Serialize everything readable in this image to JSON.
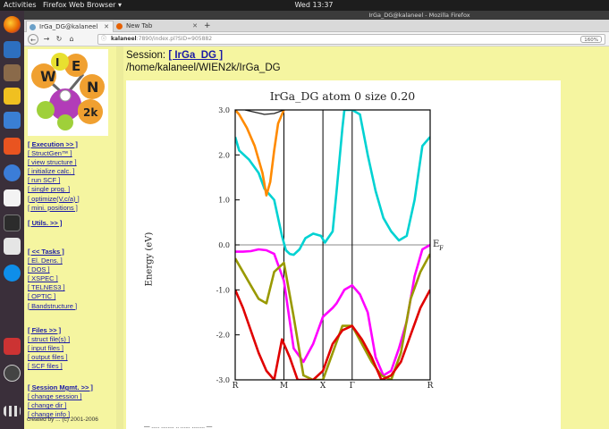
{
  "system": {
    "activities": "Activities",
    "app_menu": "Firefox Web Browser ▾",
    "clock": "Wed 13:37"
  },
  "browser": {
    "window_title": "IrGa_DG@kalaneel - Mozilla Firefox",
    "tabs": [
      {
        "label": "IrGa_DG@kalaneel",
        "active": true
      },
      {
        "label": "New Tab",
        "active": false
      }
    ],
    "new_tab": "+",
    "url_host": "kalaneel",
    "url_rest": ":7890/index.pl?SID=905882",
    "zoom": "160%"
  },
  "wien2k": {
    "session_label": "Session:",
    "session_name": "[ IrGa_DG ]",
    "session_path": "/home/kalaneel/WIEN2k/IrGa_DG",
    "menu_execution": [
      {
        "label": "[ Execution >> ]",
        "header": true
      },
      {
        "label": "[ StructGen™ ]"
      },
      {
        "label": "[ view structure ]"
      },
      {
        "label": "[ initialize calc. ]"
      },
      {
        "label": "[ run SCF ]"
      },
      {
        "label": "[ single prog. ]"
      },
      {
        "label": "[ optimize(V,c/a) ]"
      },
      {
        "label": "[ mini. positions ]"
      }
    ],
    "menu_utils": [
      {
        "label": "[ Utils. >> ]",
        "header": true
      }
    ],
    "menu_tasks": [
      {
        "label": "[ << Tasks ]",
        "header": true
      },
      {
        "label": "[ El. Dens. ]"
      },
      {
        "label": "[ DOS ]"
      },
      {
        "label": "[ XSPEC ]"
      },
      {
        "label": "[ TELNES3 ]"
      },
      {
        "label": "[ OPTIC ]"
      },
      {
        "label": "[ Bandstructure ]"
      }
    ],
    "menu_files": [
      {
        "label": "[ Files >> ]",
        "header": true
      },
      {
        "label": "[ struct file(s) ]"
      },
      {
        "label": "[ input files ]"
      },
      {
        "label": "[ output files ]"
      },
      {
        "label": "[ SCF files ]"
      }
    ],
    "menu_session": [
      {
        "label": "[ Session Mgmt. >> ]",
        "header": true
      },
      {
        "label": "[ change session ]"
      },
      {
        "label": "[ change dir ]"
      },
      {
        "label": "[ change info ]"
      }
    ],
    "footnote": "created by ... (c) 2001-2006"
  },
  "chart_data": {
    "type": "line",
    "title": "IrGa_DG atom  0    size 0.20",
    "ylabel": "Energy (eV)",
    "ylim": [
      -3.0,
      3.0
    ],
    "yticks": [
      "3.0",
      "2.0",
      "1.0",
      "0.0",
      "-1.0",
      "-2.0",
      "-3.0"
    ],
    "kpoints": [
      "R",
      "M",
      "X",
      "Γ",
      "R"
    ],
    "kpoint_positions": [
      0,
      0.25,
      0.45,
      0.6,
      1.0
    ],
    "fermi_label": "E",
    "fermi_subscript": "F",
    "fermi_level": 0.0,
    "series": [
      {
        "color": "#00d2d2",
        "x": [
          0,
          0.02,
          0.07,
          0.12,
          0.15,
          0.2,
          0.24,
          0.26,
          0.28,
          0.3,
          0.33,
          0.36,
          0.4,
          0.44,
          0.46,
          0.5,
          0.52,
          0.55,
          0.56,
          0.6,
          0.64,
          0.68,
          0.72,
          0.76,
          0.8,
          0.84,
          0.88,
          0.92,
          0.96,
          1.0
        ],
        "y": [
          2.4,
          2.1,
          1.9,
          1.6,
          1.25,
          1.0,
          0.2,
          -0.12,
          -0.2,
          -0.22,
          -0.1,
          0.15,
          0.25,
          0.2,
          0.05,
          0.3,
          1.2,
          2.6,
          3.0,
          3.0,
          2.9,
          2.0,
          1.2,
          0.6,
          0.3,
          0.1,
          0.2,
          1.0,
          2.2,
          2.4
        ]
      },
      {
        "color": "#ff8a00",
        "x": [
          0,
          0.02,
          0.06,
          0.1,
          0.14,
          0.16,
          0.18,
          0.2,
          0.22,
          0.25
        ],
        "y": [
          3.0,
          2.9,
          2.6,
          2.2,
          1.6,
          1.1,
          1.4,
          2.1,
          2.7,
          3.0
        ]
      },
      {
        "color": "#ff00ff",
        "x": [
          0,
          0.04,
          0.08,
          0.12,
          0.16,
          0.2,
          0.25,
          0.3,
          0.35,
          0.4,
          0.45,
          0.5,
          0.52,
          0.56,
          0.6,
          0.64,
          0.68,
          0.72,
          0.76,
          0.8,
          0.84,
          0.88,
          0.92,
          0.96,
          1.0
        ],
        "y": [
          -0.15,
          -0.15,
          -0.14,
          -0.1,
          -0.12,
          -0.2,
          -0.8,
          -2.3,
          -2.6,
          -2.2,
          -1.6,
          -1.4,
          -1.3,
          -1.0,
          -0.9,
          -1.1,
          -1.5,
          -2.5,
          -2.9,
          -2.8,
          -2.3,
          -1.7,
          -0.7,
          -0.1,
          0.0
        ]
      },
      {
        "color": "#999900",
        "x": [
          0,
          0.04,
          0.08,
          0.12,
          0.16,
          0.2,
          0.25,
          0.3,
          0.35,
          0.4,
          0.45,
          0.5,
          0.55,
          0.6,
          0.65,
          0.7,
          0.75,
          0.8,
          0.85,
          0.9,
          0.95,
          1.0
        ],
        "y": [
          -0.3,
          -0.6,
          -0.9,
          -1.2,
          -1.3,
          -0.6,
          -0.4,
          -1.6,
          -2.9,
          -3.0,
          -3.0,
          -2.4,
          -1.8,
          -1.8,
          -2.2,
          -2.6,
          -2.9,
          -3.0,
          -2.4,
          -1.2,
          -0.6,
          -0.2
        ]
      },
      {
        "color": "#e00000",
        "x": [
          0,
          0.04,
          0.08,
          0.12,
          0.16,
          0.2,
          0.24,
          0.28,
          0.32,
          0.36,
          0.4,
          0.45,
          0.5,
          0.55,
          0.6,
          0.65,
          0.7,
          0.75,
          0.8,
          0.85,
          0.9,
          0.95,
          1.0
        ],
        "y": [
          -1.0,
          -1.4,
          -1.9,
          -2.4,
          -2.8,
          -3.0,
          -2.1,
          -2.5,
          -3.0,
          -3.0,
          -3.0,
          -2.8,
          -2.2,
          -1.9,
          -1.8,
          -2.1,
          -2.5,
          -3.0,
          -2.9,
          -2.6,
          -2.0,
          -1.4,
          -1.0
        ]
      },
      {
        "color": "#202020",
        "x": [
          0.05,
          0.1,
          0.15,
          0.2,
          0.25
        ],
        "y": [
          3.0,
          2.95,
          2.9,
          2.92,
          3.0
        ]
      }
    ]
  },
  "bottom_text": "— ..... ........ ..  ...... ........ —"
}
